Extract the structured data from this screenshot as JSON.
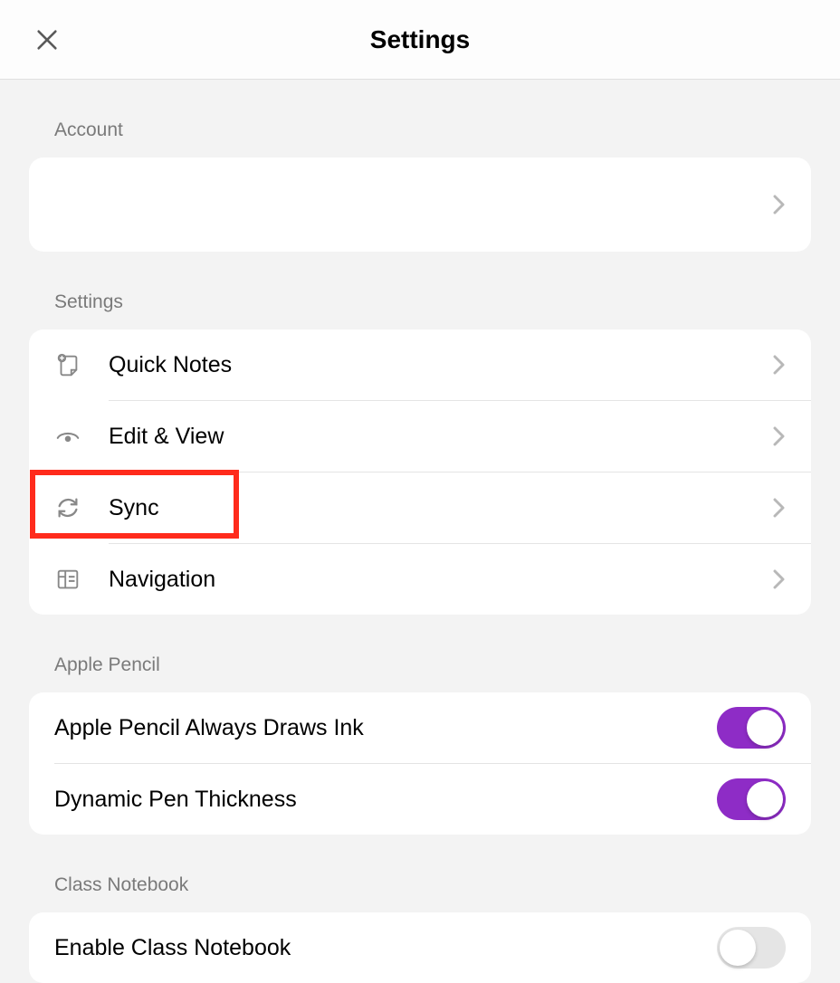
{
  "header": {
    "title": "Settings"
  },
  "sections": {
    "account": {
      "label": "Account"
    },
    "settings": {
      "label": "Settings",
      "items": [
        {
          "label": "Quick Notes"
        },
        {
          "label": "Edit & View"
        },
        {
          "label": "Sync"
        },
        {
          "label": "Navigation"
        }
      ]
    },
    "apple_pencil": {
      "label": "Apple Pencil",
      "items": [
        {
          "label": "Apple Pencil Always Draws Ink",
          "on": true
        },
        {
          "label": "Dynamic Pen Thickness",
          "on": true
        }
      ]
    },
    "class_notebook": {
      "label": "Class Notebook",
      "items": [
        {
          "label": "Enable Class Notebook",
          "on": false
        }
      ]
    }
  }
}
